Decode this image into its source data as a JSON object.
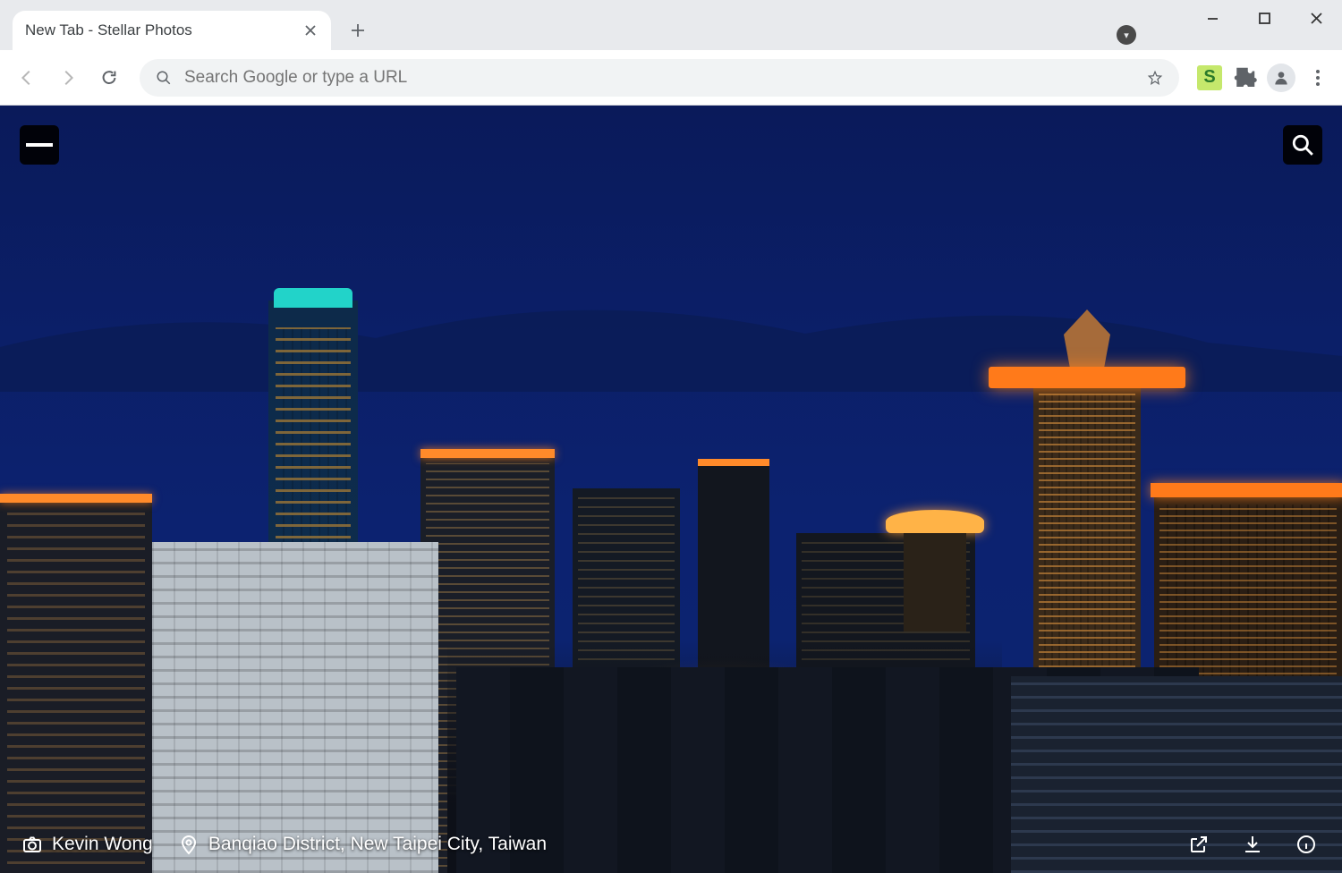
{
  "browser": {
    "tab_title": "New Tab - Stellar Photos",
    "omnibox_placeholder": "Search Google or type a URL"
  },
  "photo": {
    "author": "Kevin Wong",
    "location": "Banqiao District, New Taipei City, Taiwan"
  }
}
